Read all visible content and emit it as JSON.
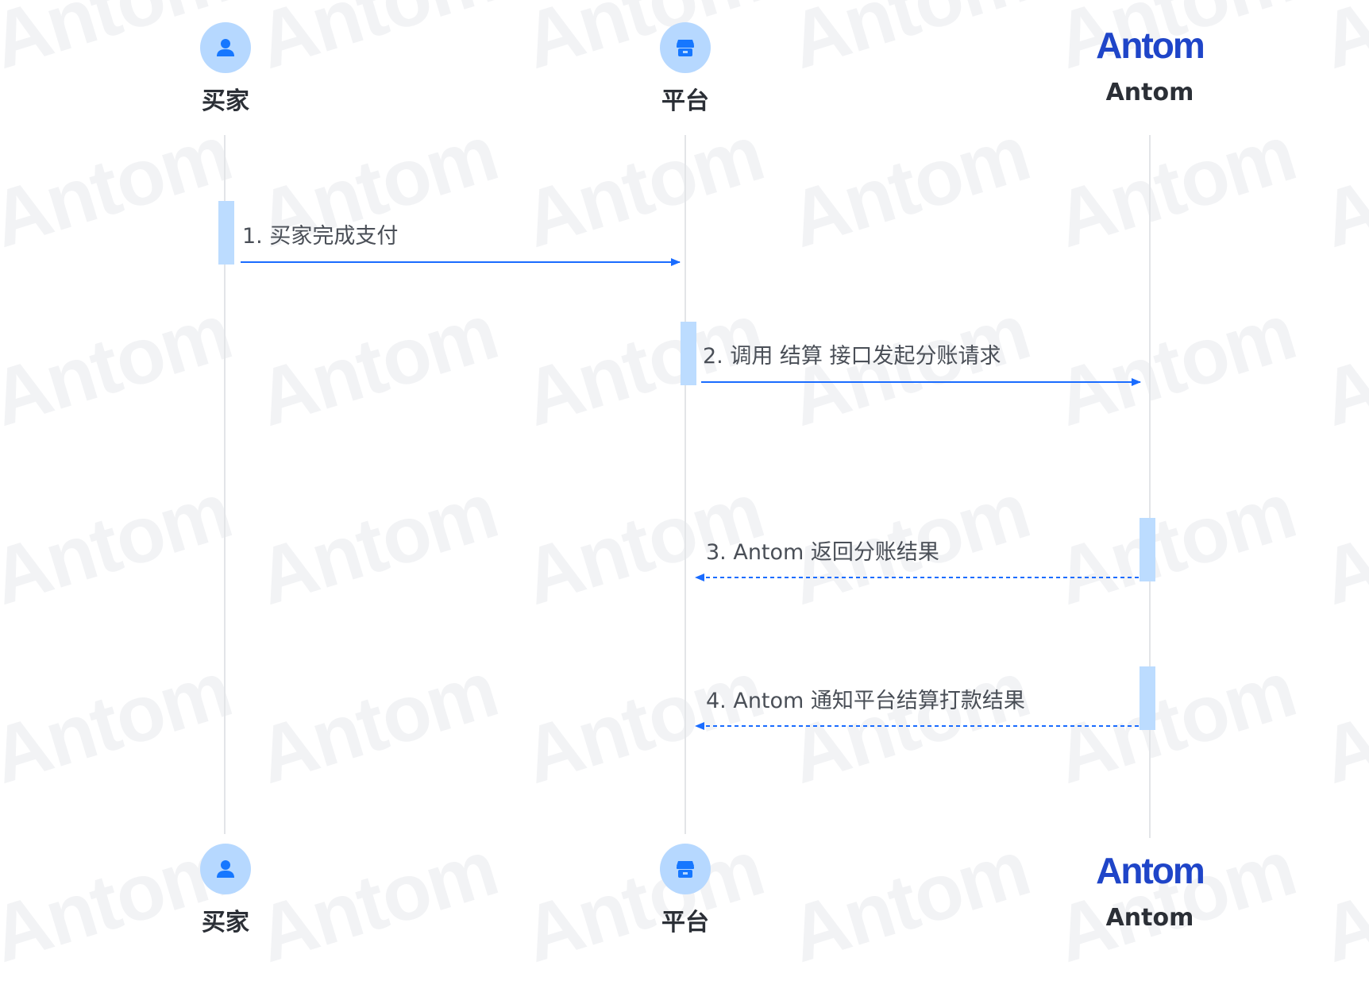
{
  "watermark": {
    "text": "Antom"
  },
  "participants": {
    "buyer": {
      "label": "买家",
      "icon": "person-icon"
    },
    "platform": {
      "label": "平台",
      "icon": "store-icon"
    },
    "antom": {
      "label": "Antom",
      "logo_text": "Antom",
      "icon": "antom-logo"
    }
  },
  "messages": [
    {
      "label": "1. 买家完成支付",
      "from": "buyer",
      "to": "platform",
      "style": "solid"
    },
    {
      "label": "2. 调用 结算 接口发起分账请求",
      "from": "platform",
      "to": "antom",
      "style": "solid"
    },
    {
      "label": "3. Antom 返回分账结果",
      "from": "antom",
      "to": "platform",
      "style": "dashed"
    },
    {
      "label": "4. Antom 通知平台结算打款结果",
      "from": "antom",
      "to": "platform",
      "style": "dashed"
    }
  ],
  "colors": {
    "arrow": "#1a6cff",
    "activation": "#bcdcff",
    "lifeline": "#e3e5e8",
    "avatar_bg": "#b6d8ff",
    "avatar_icon": "#1677ff",
    "logo": "#1f45c8",
    "text": "#2b2f36"
  }
}
